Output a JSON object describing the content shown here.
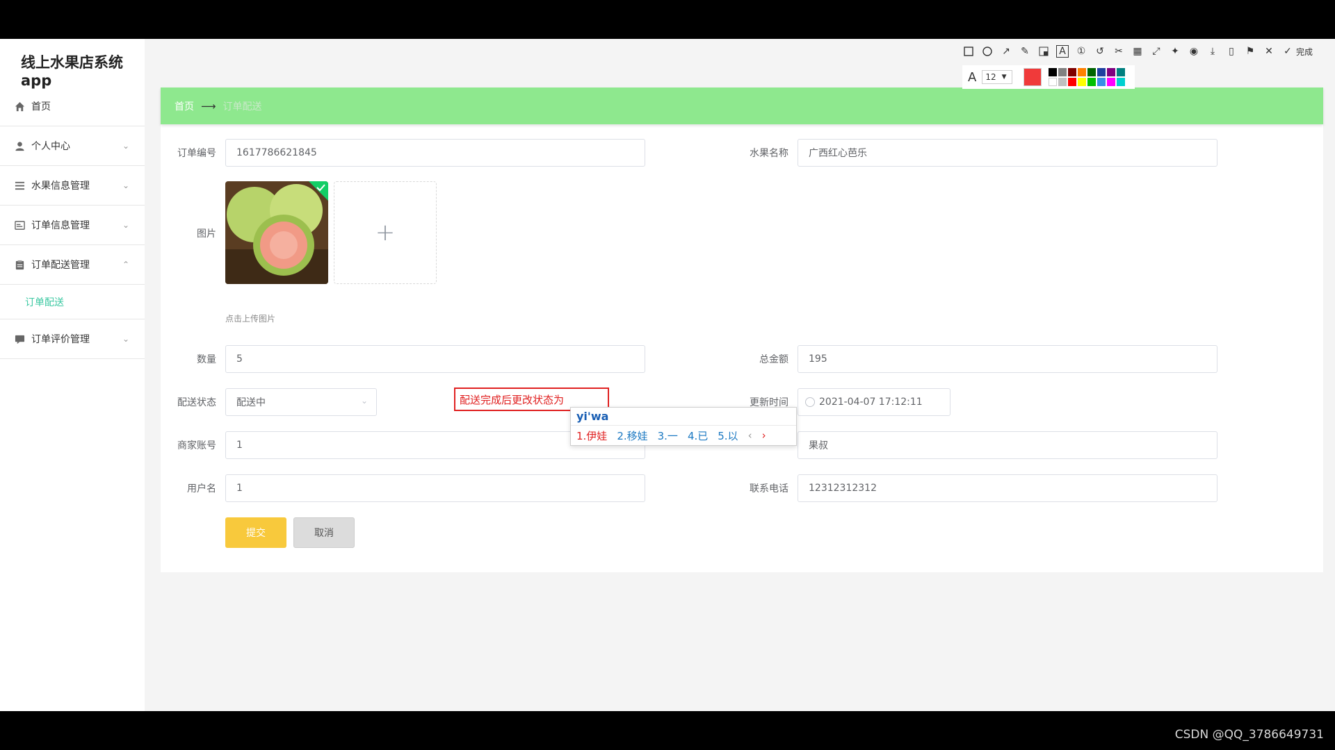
{
  "app": {
    "title": "线上水果店系统app"
  },
  "sidebar": {
    "items": [
      {
        "label": "首页",
        "icon": "home-icon"
      },
      {
        "label": "个人中心",
        "icon": "user-icon"
      },
      {
        "label": "水果信息管理",
        "icon": "list-icon"
      },
      {
        "label": "订单信息管理",
        "icon": "order-icon"
      },
      {
        "label": "订单配送管理",
        "icon": "clipboard-icon"
      },
      {
        "label": "订单评价管理",
        "icon": "comment-icon"
      }
    ],
    "active_sub": "订单配送"
  },
  "breadcrumb": {
    "home": "首页",
    "current": "订单配送"
  },
  "form": {
    "order_no_label": "订单编号",
    "order_no": "1617786621845",
    "fruit_name_label": "水果名称",
    "fruit_name": "广西红心芭乐",
    "image_label": "图片",
    "upload_hint": "点击上传图片",
    "qty_label": "数量",
    "qty": "5",
    "total_label": "总金额",
    "total": "195",
    "status_label": "配送状态",
    "status": "配送中",
    "update_time_label": "更新时间",
    "update_time": "2021-04-07 17:12:11",
    "merchant_acct_label": "商家账号",
    "merchant_acct": "1",
    "merchant_name": "果叔",
    "username_label": "用户名",
    "username": "1",
    "phone_label": "联系电话",
    "phone": "12312312312",
    "submit": "提交",
    "cancel": "取消"
  },
  "annotation": {
    "text": "配送完成后更改状态为"
  },
  "ime": {
    "composition": "yi'wa",
    "candidates": [
      "1.伊娃",
      "2.移娃",
      "3.一",
      "4.已",
      "5.以"
    ]
  },
  "toolbar": {
    "font_size": "12",
    "done": "完成",
    "accent": "#f03a3a"
  },
  "watermark": "CSDN @QQ_3786649731"
}
